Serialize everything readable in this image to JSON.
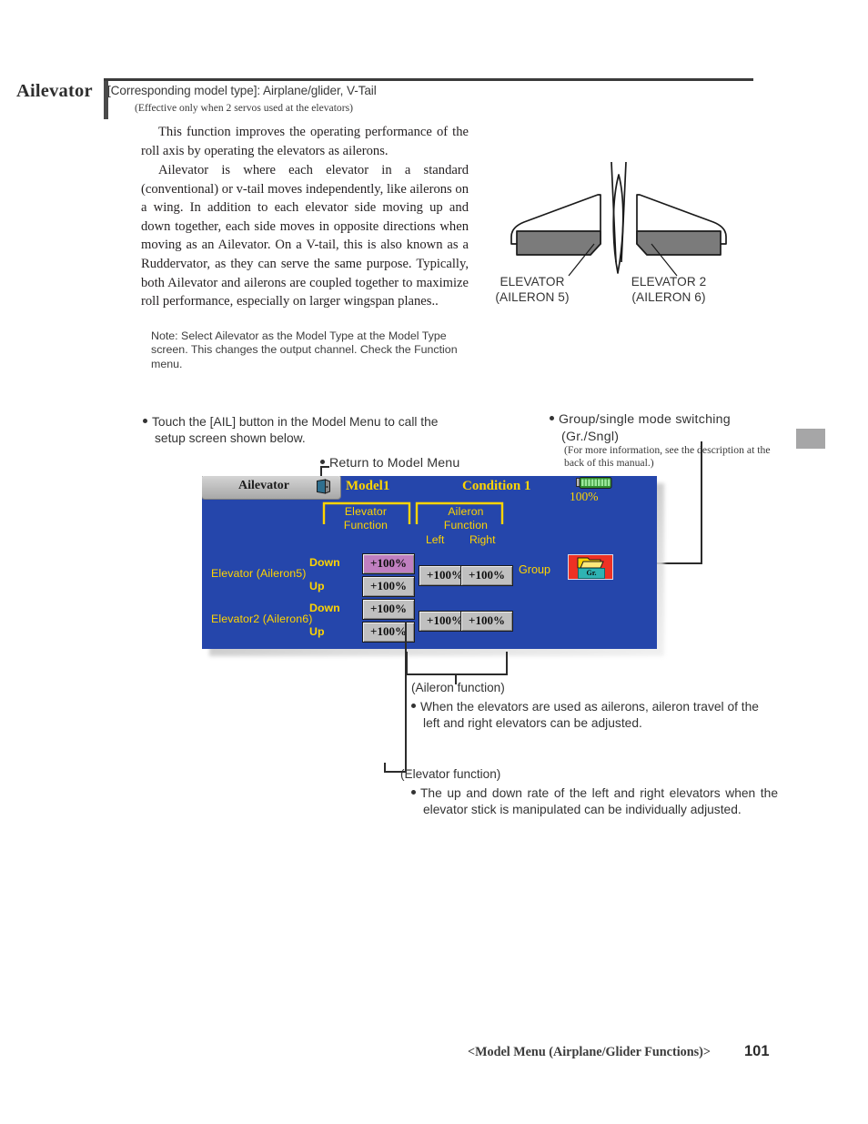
{
  "header": {
    "section_title": "Ailevator",
    "model_type": "[Corresponding model type]: Airplane/glider, V-Tail",
    "effective_note": "(Effective only when 2 servos used at the elevators)"
  },
  "body": {
    "para1": "This function improves the operating performance of the roll axis by operating the elevators as ailerons.",
    "para2": "Ailevator is where each elevator in a standard (conventional) or v-tail moves independently, like ailerons on a wing. In addition to each elevator side moving up and down together, each side moves in opposite directions when moving as an Ailevator. On a V-tail, this is also known as a Ruddervator, as they can serve the same purpose. Typically, both Ailevator and ailerons are coupled together to maximize roll performance, especially on larger wingspan planes..",
    "note": "Note: Select Ailevator as the Model Type at the Model Type screen. This changes the output channel. Check the Function menu."
  },
  "figure": {
    "label_left_line1": "ELEVATOR",
    "label_left_line2": "(AILERON 5)",
    "label_right_line1": "ELEVATOR 2",
    "label_right_line2": "(AILERON 6)"
  },
  "callouts": {
    "touch": "Touch the [AIL] button in the Model Menu to call the setup screen shown below.",
    "return_to_model_menu": "Return to Model Menu",
    "group_switch": "Group/single mode switching (Gr./Sngl)",
    "group_switch_sub": "(For more information, see the description at the back of this manual.)",
    "aileron_caption": "(Aileron function)",
    "aileron_text": "When the elevators are used as ailerons, aileron travel of the left and right elevators can be adjusted.",
    "elevator_caption": "(Elevator function)",
    "elevator_text": "The up and down rate of the left and right elevators when the elevator stick is manipulated can be individually adjusted."
  },
  "lcd": {
    "title": "Ailevator",
    "model": "Model1",
    "condition": "Condition 1",
    "battery": "100%",
    "bracket_elevator": "Elevator Function",
    "bracket_aileron": "Aileron Function",
    "col_left": "Left",
    "col_right": "Right",
    "group_label": "Group",
    "group_button_text": "Gr.",
    "rows": [
      {
        "label": "Elevator  (Aileron5)",
        "down_label": "Down",
        "up_label": "Up",
        "elevator_down": "+100%",
        "elevator_up": "+100%",
        "aileron_left": "+100%",
        "aileron_right": "+100%"
      },
      {
        "label": "Elevator2 (Aileron6)",
        "down_label": "Down",
        "up_label": "Up",
        "elevator_down": "+100%",
        "elevator_up": "+100%",
        "aileron_left": "+100%",
        "aileron_right": "+100%"
      }
    ],
    "colors": {
      "background": "#2546ab",
      "text": "#ffd400",
      "value_box": "#c0c0c0",
      "value_box_selected": "#c07fc0",
      "group_button": "#ee3124"
    }
  },
  "footer": {
    "chapter": "<Model Menu (Airplane/Glider Functions)>",
    "page_number": "101"
  }
}
